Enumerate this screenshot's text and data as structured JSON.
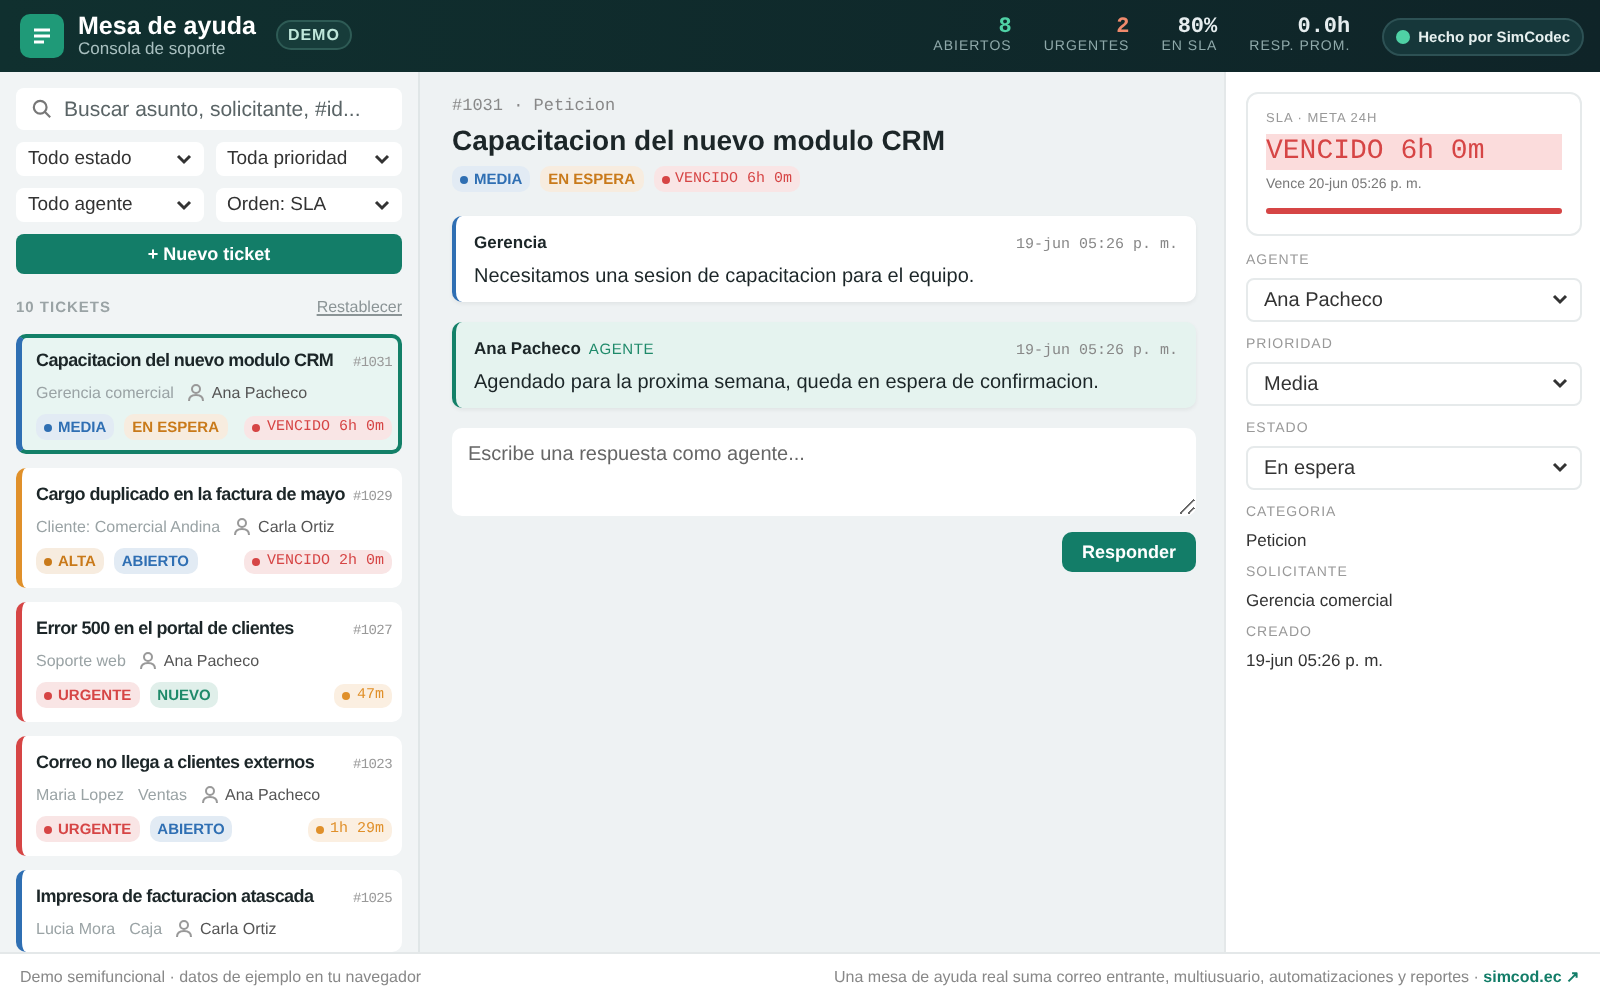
{
  "header": {
    "title": "Mesa de ayuda",
    "subtitle": "Consola de soporte",
    "badge": "DEMO",
    "stats": [
      {
        "value": "8",
        "label": "ABIERTOS",
        "color": "#4fd1a5"
      },
      {
        "value": "2",
        "label": "URGENTES",
        "color": "#f08a6c"
      },
      {
        "value": "80%",
        "label": "EN SLA",
        "color": "#e6edef"
      },
      {
        "value": "0.0h",
        "label": "RESP. PROM.",
        "color": "#e6edef"
      }
    ],
    "credit": "Hecho por SimCodec"
  },
  "sidebar": {
    "search": {
      "placeholder": "Buscar asunto, solicitante, #id..."
    },
    "filters": [
      "Todo estado",
      "Toda prioridad",
      "Todo agente",
      "Orden: SLA"
    ],
    "new_button": "+ Nuevo ticket",
    "count": "10 TICKETS",
    "reset": "Restablecer",
    "tickets": [
      {
        "title": "Capacitacion del nuevo modulo CRM",
        "id": "#1031",
        "meta": [
          "Gerencia comercial"
        ],
        "agent": "Ana Pacheco",
        "color": "#2f6fb3",
        "selected": true,
        "badges": [
          {
            "label": "MEDIA",
            "color": "#2f6fb3",
            "dot": true
          },
          {
            "label": "EN ESPERA",
            "color": "#c97a1a",
            "dot": false
          }
        ],
        "sla": {
          "label": "VENCIDO 6h 0m",
          "color": "#d64545"
        }
      },
      {
        "title": "Cargo duplicado en la factura de mayo",
        "id": "#1029",
        "meta": [
          "Cliente: Comercial Andina"
        ],
        "agent": "Carla Ortiz",
        "color": "#e0902a",
        "selected": false,
        "badges": [
          {
            "label": "ALTA",
            "color": "#c97a1a",
            "dot": true
          },
          {
            "label": "ABIERTO",
            "color": "#2f6fb3",
            "dot": false
          }
        ],
        "sla": {
          "label": "VENCIDO 2h 0m",
          "color": "#d64545"
        }
      },
      {
        "title": "Error 500 en el portal de clientes",
        "id": "#1027",
        "meta": [
          "Soporte web"
        ],
        "agent": "Ana Pacheco",
        "color": "#d64545",
        "selected": false,
        "badges": [
          {
            "label": "URGENTE",
            "color": "#d64545",
            "dot": true
          },
          {
            "label": "NUEVO",
            "color": "#1f8a6a",
            "dot": false
          }
        ],
        "sla": {
          "label": "47m",
          "color": "#e0902a"
        }
      },
      {
        "title": "Correo no llega a clientes externos",
        "id": "#1023",
        "meta": [
          "Maria Lopez",
          "Ventas"
        ],
        "agent": "Ana Pacheco",
        "color": "#d64545",
        "selected": false,
        "badges": [
          {
            "label": "URGENTE",
            "color": "#d64545",
            "dot": true
          },
          {
            "label": "ABIERTO",
            "color": "#2f6fb3",
            "dot": false
          }
        ],
        "sla": {
          "label": "1h 29m",
          "color": "#e0902a"
        }
      },
      {
        "title": "Impresora de facturacion atascada",
        "id": "#1025",
        "meta": [
          "Lucia Mora",
          "Caja"
        ],
        "agent": "Carla Ortiz",
        "color": "#2f6fb3",
        "selected": false
      }
    ]
  },
  "detail": {
    "ref": "#1031 · Peticion",
    "title": "Capacitacion del nuevo modulo CRM",
    "badges": [
      {
        "label": "MEDIA",
        "color": "#2f6fb3",
        "dot": true,
        "mono": false
      },
      {
        "label": "EN ESPERA",
        "color": "#c97a1a",
        "dot": false,
        "mono": false
      },
      {
        "label": "VENCIDO 6h 0m",
        "color": "#d64545",
        "dot": true,
        "mono": true
      }
    ],
    "messages": [
      {
        "kind": "requester",
        "author": "Gerencia",
        "time": "19-jun 05:26 p. m.",
        "text": "Necesitamos una sesion de capacitacion para el equipo."
      },
      {
        "kind": "agent",
        "author": "Ana Pacheco",
        "role": "AGENTE",
        "time": "19-jun 05:26 p. m.",
        "text": "Agendado para la proxima semana, queda en espera de confirmacion."
      }
    ],
    "reply": {
      "placeholder": "Escribe una respuesta como agente..."
    },
    "reply_button": "Responder"
  },
  "panel": {
    "sla": {
      "label": "SLA · META 24H",
      "status": "VENCIDO 6h 0m",
      "due": "Vence 20-jun 05:26 p. m.",
      "level": 1.0
    },
    "selects": [
      {
        "label": "AGENTE",
        "value": "Ana Pacheco"
      },
      {
        "label": "PRIORIDAD",
        "value": "Media"
      },
      {
        "label": "ESTADO",
        "value": "En espera"
      }
    ],
    "facts": [
      {
        "label": "CATEGORIA",
        "value": "Peticion"
      },
      {
        "label": "SOLICITANTE",
        "value": "Gerencia comercial"
      },
      {
        "label": "CREADO",
        "value": "19-jun 05:26 p. m."
      }
    ]
  },
  "footer": {
    "left": "Demo semifuncional · datos de ejemplo en tu navegador",
    "right": "Una mesa de ayuda real suma correo entrante, multiusuario, automatizaciones y reportes · ",
    "link": "simcod.ec ↗"
  }
}
